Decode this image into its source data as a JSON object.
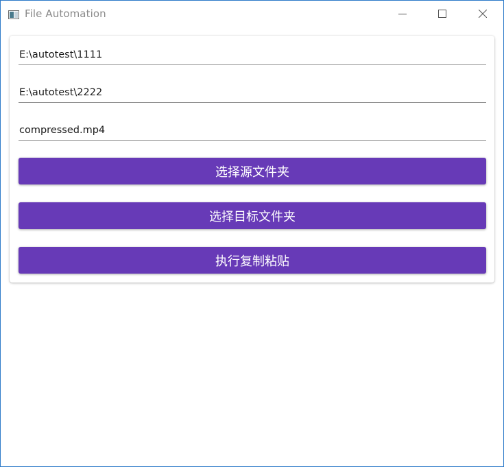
{
  "window": {
    "title": "File Automation"
  },
  "fields": {
    "source_path": "E:\\autotest\\1111",
    "target_path": "E:\\autotest\\2222",
    "file_name": "compressed.mp4"
  },
  "buttons": {
    "select_source": "选择源文件夹",
    "select_target": "选择目标文件夹",
    "execute_copy": "执行复制粘贴"
  },
  "colors": {
    "accent": "#673ab7",
    "window_border": "#2b79c9"
  }
}
